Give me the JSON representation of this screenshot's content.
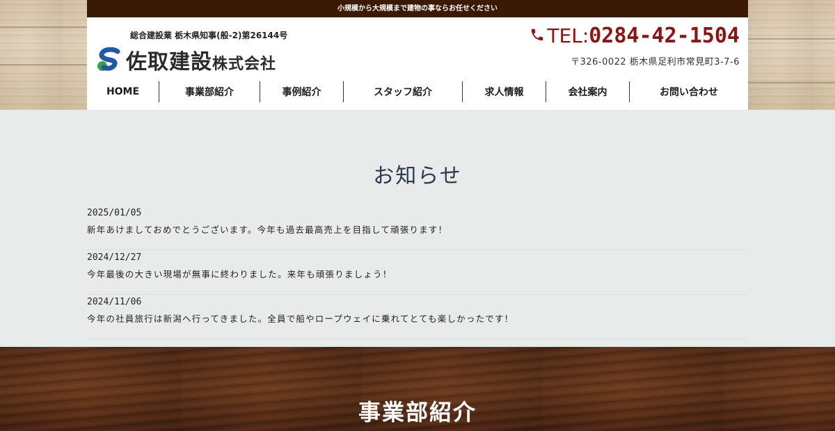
{
  "topbar": {
    "text": "小規模から大規模まで建物の事ならお任せください"
  },
  "header": {
    "license": "総合建設業 栃木県知事(般-2)第26144号",
    "company_name": "佐取建設",
    "company_suffix": "株式会社",
    "tel_label": "TEL:",
    "tel_number": "0284-42-1504",
    "address": "〒326-0022 栃木県足利市常見町3-7-6"
  },
  "nav": {
    "items": [
      {
        "label": "HOME"
      },
      {
        "label": "事業部紹介"
      },
      {
        "label": "事例紹介"
      },
      {
        "label": "スタッフ紹介"
      },
      {
        "label": "求人情報"
      },
      {
        "label": "会社案内"
      },
      {
        "label": "お問い合わせ"
      }
    ]
  },
  "news": {
    "title": "お知らせ",
    "entries": [
      {
        "date": "2025/01/05",
        "text": "新年あけましておめでとうございます。今年も過去最高売上を目指して頑張ります！"
      },
      {
        "date": "2024/12/27",
        "text": "今年最後の大きい現場が無事に終わりました。来年も頑張りましょう！"
      },
      {
        "date": "2024/11/06",
        "text": "今年の社員旅行は新潟へ行ってきました。全員で船やロープウェイに乗れてとても楽しかったです！"
      }
    ]
  },
  "business": {
    "title": "事業部紹介"
  },
  "colors": {
    "topbar": "#3a1a05",
    "tel": "#8e1313",
    "logo_blue": "#1e5aa8",
    "logo_green": "#3aa14a"
  },
  "icons": {
    "phone": "phone-icon",
    "logo": "company-logo-mark"
  }
}
